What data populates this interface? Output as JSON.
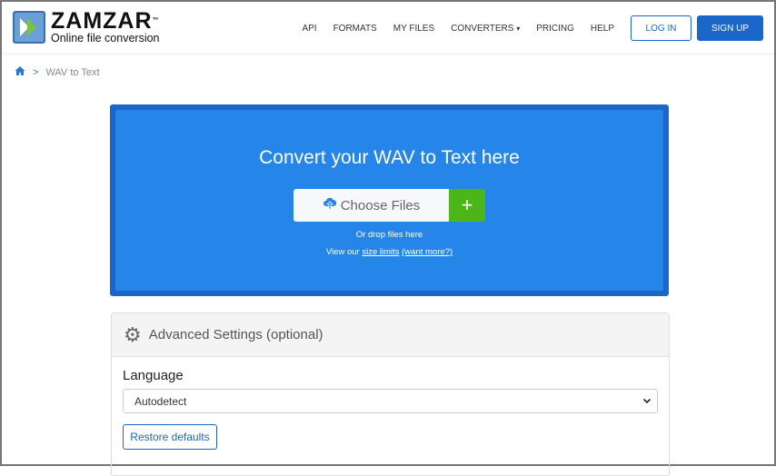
{
  "brand": {
    "name": "ZAMZAR",
    "tm": "™",
    "tagline": "Online file conversion"
  },
  "nav": {
    "items": [
      "API",
      "FORMATS",
      "MY FILES",
      "CONVERTERS",
      "PRICING",
      "HELP"
    ],
    "login": "LOG IN",
    "signup": "SIGN UP",
    "dropdown": "▾"
  },
  "breadcrumb": {
    "sep": ">",
    "current": "WAV to Text"
  },
  "hero": {
    "title": "Convert your WAV to Text here",
    "choose": "Choose Files",
    "plus": "+",
    "drop": "Or drop files here",
    "limits_prefix": "View our ",
    "size_limits": "size limits",
    "want_more": "(want more?)"
  },
  "advanced": {
    "title": "Advanced Settings (optional)",
    "language_label": "Language",
    "language_value": "Autodetect",
    "restore": "Restore defaults"
  }
}
